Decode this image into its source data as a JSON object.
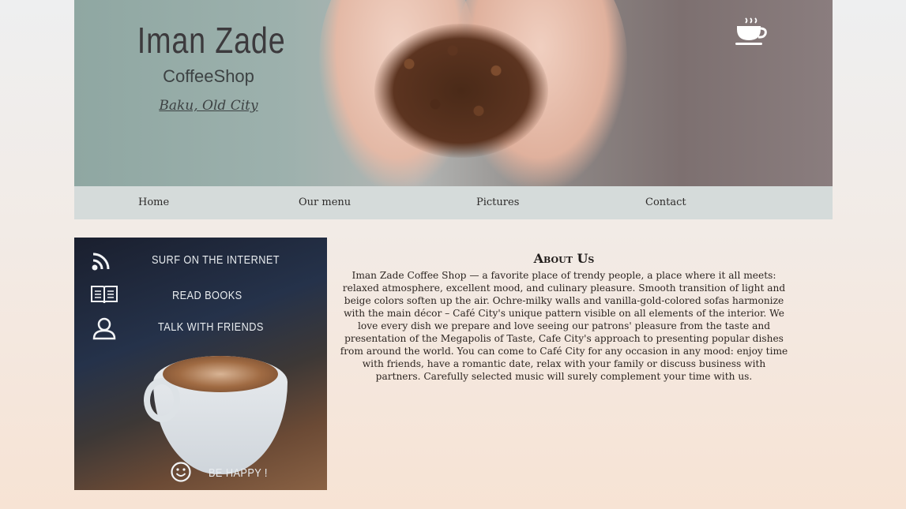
{
  "header": {
    "brand_name": "Iman Zade",
    "brand_sub": "CoffeeShop",
    "location": "Baku, Old City",
    "icon": "coffee-cup-icon"
  },
  "nav": {
    "items": [
      {
        "label": "Home"
      },
      {
        "label": "Our menu"
      },
      {
        "label": "Pictures"
      },
      {
        "label": "Contact"
      }
    ]
  },
  "promo": {
    "items": [
      {
        "icon": "rss-icon",
        "label": "SURF ON THE INTERNET"
      },
      {
        "icon": "book-icon",
        "label": "READ BOOKS"
      },
      {
        "icon": "user-icon",
        "label": "TALK WITH FRIENDS"
      },
      {
        "icon": "smiley-icon",
        "label": "BE HAPPY !"
      }
    ]
  },
  "about": {
    "title": "About Us",
    "text": "Iman Zade Coffee Shop — a favorite place of trendy people, a place where it all meets: relaxed atmosphere, excellent mood, and culinary pleasure. Smooth transition of light and beige colors soften up the air. Ochre-milky walls and vanilla-gold-colored sofas harmonize with the main décor – Café City's unique pattern visible on all elements of the interior. We love every dish we prepare and love seeing our patrons' pleasure from the taste and presentation of the Megapolis of Taste, Cafe City's approach to presenting popular dishes from around the world. You can come to Café City for any occasion in any mood: enjoy time with friends, have a romantic date, relax with your family or discuss business with partners. Carefully selected music will surely complement your time with us."
  }
}
